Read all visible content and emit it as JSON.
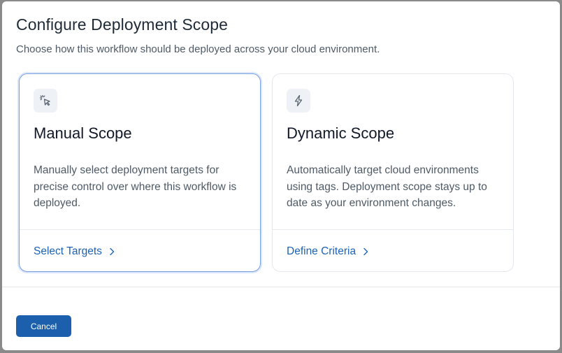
{
  "dialog": {
    "title": "Configure Deployment Scope",
    "subtitle": "Choose how this workflow should be deployed across your cloud environment."
  },
  "cards": [
    {
      "icon": "click-cursor-icon",
      "title": "Manual Scope",
      "description": "Manually select deployment targets for precise control over where this workflow is deployed.",
      "link_label": "Select Targets",
      "selected": true
    },
    {
      "icon": "lightning-bolt-icon",
      "title": "Dynamic Scope",
      "description": "Automatically target cloud environments using tags. Deployment scope stays up to date as your environment changes.",
      "link_label": "Define Criteria",
      "selected": false
    }
  ],
  "footer": {
    "cancel_label": "Cancel"
  },
  "colors": {
    "accent": "#1b5fad",
    "link": "#1c63b5",
    "selected_border": "#7aa0e0"
  }
}
